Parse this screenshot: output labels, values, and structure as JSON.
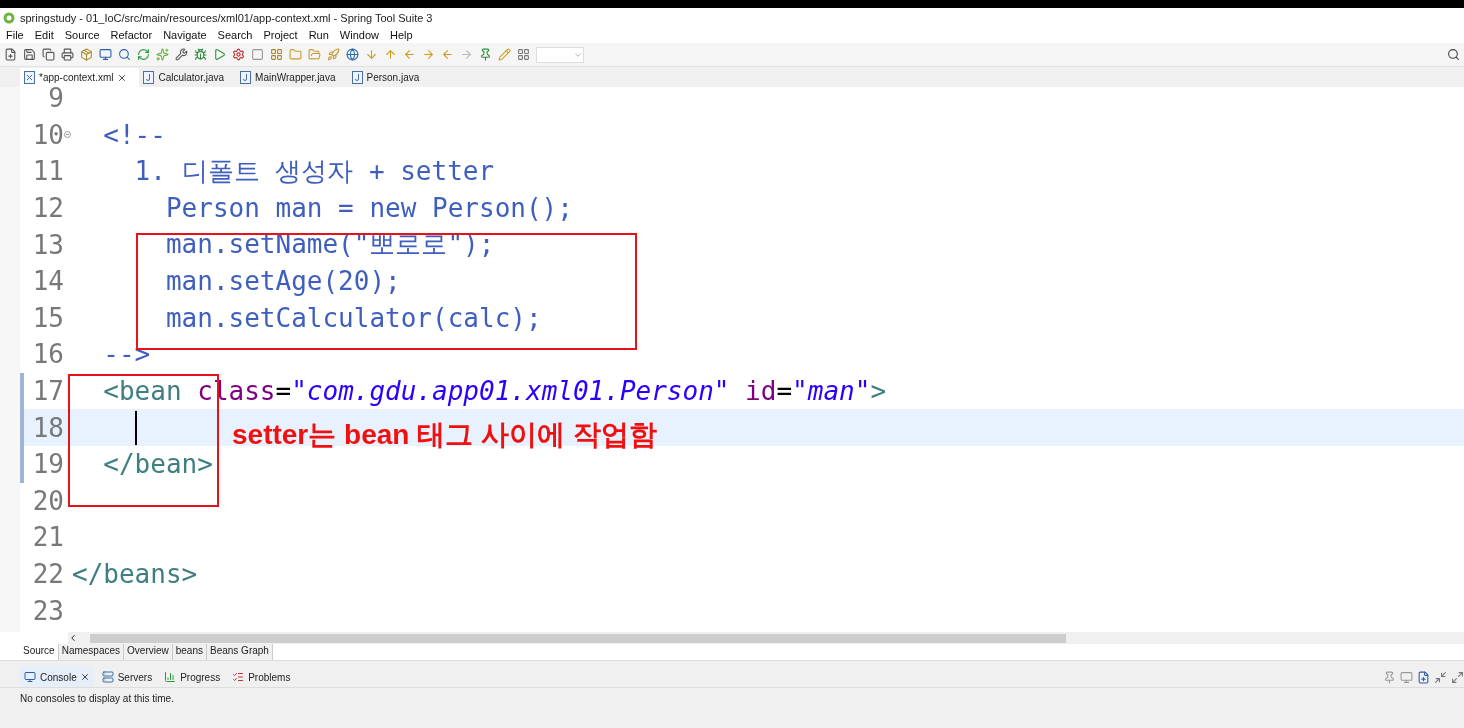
{
  "window": {
    "title": "springstudy - 01_IoC/src/main/resources/xml01/app-context.xml - Spring Tool Suite 3"
  },
  "menu": [
    "File",
    "Edit",
    "Source",
    "Refactor",
    "Navigate",
    "Search",
    "Project",
    "Run",
    "Window",
    "Help"
  ],
  "editor_tabs": [
    {
      "label": "*app-context.xml",
      "selected": true,
      "kind": "xml"
    },
    {
      "label": "Calculator.java",
      "selected": false,
      "kind": "java"
    },
    {
      "label": "MainWrapper.java",
      "selected": false,
      "kind": "java"
    },
    {
      "label": "Person.java",
      "selected": false,
      "kind": "java"
    }
  ],
  "editor": {
    "lines": [
      {
        "number": "9",
        "current": false,
        "changed": false,
        "foldable": false
      },
      {
        "number": "10",
        "current": false,
        "changed": false,
        "foldable": true,
        "tokens": [
          {
            "kind": "comment",
            "text": "  <!--"
          }
        ]
      },
      {
        "number": "11",
        "current": false,
        "changed": false,
        "foldable": false,
        "tokens": [
          {
            "kind": "comment",
            "text": "    1. 디폴트 생성자 + setter"
          }
        ]
      },
      {
        "number": "12",
        "current": false,
        "changed": false,
        "foldable": false,
        "tokens": [
          {
            "kind": "comment",
            "text": "      Person man = new Person();"
          }
        ]
      },
      {
        "number": "13",
        "current": false,
        "changed": false,
        "foldable": false,
        "tokens": [
          {
            "kind": "comment",
            "text": "      man.setName(\"뽀로로\");"
          }
        ]
      },
      {
        "number": "14",
        "current": false,
        "changed": false,
        "foldable": false,
        "tokens": [
          {
            "kind": "comment",
            "text": "      man.setAge(20);"
          }
        ]
      },
      {
        "number": "15",
        "current": false,
        "changed": false,
        "foldable": false,
        "tokens": [
          {
            "kind": "comment",
            "text": "      man.setCalculator(calc);"
          }
        ]
      },
      {
        "number": "16",
        "current": false,
        "changed": false,
        "foldable": false,
        "tokens": [
          {
            "kind": "comment",
            "text": "  -->"
          }
        ]
      },
      {
        "number": "17",
        "current": false,
        "changed": true,
        "foldable": false,
        "tokens": [
          {
            "kind": "tag",
            "text": "  <bean "
          },
          {
            "kind": "attr",
            "text": "class"
          },
          {
            "kind": "plain",
            "text": "="
          },
          {
            "kind": "value",
            "text": "\"com.gdu.app01.xml01.Person\""
          },
          {
            "kind": "attr",
            "text": " id"
          },
          {
            "kind": "plain",
            "text": "="
          },
          {
            "kind": "value",
            "text": "\"man\""
          },
          {
            "kind": "tag",
            "text": ">"
          }
        ]
      },
      {
        "number": "18",
        "current": true,
        "changed": true,
        "foldable": false
      },
      {
        "number": "19",
        "current": false,
        "changed": true,
        "foldable": false,
        "tokens": [
          {
            "kind": "tag",
            "text": "  </bean>"
          }
        ]
      },
      {
        "number": "20",
        "current": false,
        "changed": false,
        "foldable": false
      },
      {
        "number": "21",
        "current": false,
        "changed": false,
        "foldable": false
      },
      {
        "number": "22",
        "current": false,
        "changed": false,
        "foldable": false,
        "tokens": [
          {
            "kind": "tag",
            "text": "</beans>"
          }
        ]
      },
      {
        "number": "23",
        "current": false,
        "changed": false,
        "foldable": false
      }
    ]
  },
  "annotation": {
    "note": "setter는 bean 태그 사이에 작업함"
  },
  "page_tabs": [
    {
      "label": "Source",
      "selected": true
    },
    {
      "label": "Namespaces",
      "selected": false
    },
    {
      "label": "Overview",
      "selected": false
    },
    {
      "label": "beans",
      "selected": false
    },
    {
      "label": "Beans Graph",
      "selected": false
    }
  ],
  "views": [
    {
      "label": "Console",
      "selected": true,
      "kind": "console"
    },
    {
      "label": "Servers",
      "selected": false,
      "kind": "servers"
    },
    {
      "label": "Progress",
      "selected": false,
      "kind": "progress"
    },
    {
      "label": "Problems",
      "selected": false,
      "kind": "problems"
    }
  ],
  "console": {
    "message": "No consoles to display at this time."
  }
}
